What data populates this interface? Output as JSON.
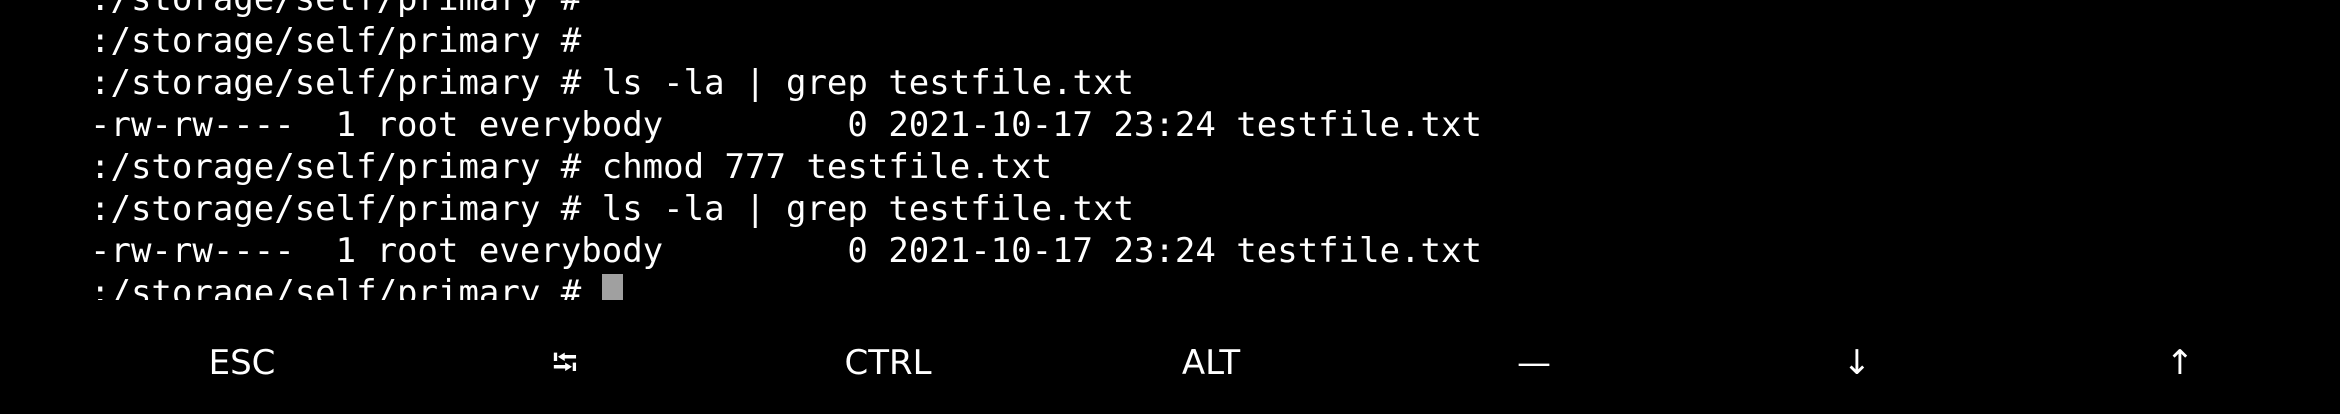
{
  "terminal": {
    "lines": [
      ":/storage/self/primary #",
      ":/storage/self/primary #",
      ":/storage/self/primary # ls -la | grep testfile.txt",
      "-rw-rw----  1 root everybody         0 2021-10-17 23:24 testfile.txt",
      ":/storage/self/primary # chmod 777 testfile.txt",
      ":/storage/self/primary # ls -la | grep testfile.txt",
      "-rw-rw----  1 root everybody         0 2021-10-17 23:24 testfile.txt"
    ],
    "prompt": ":/storage/self/primary #"
  },
  "extra_keys": {
    "esc": "ESC",
    "tab": "⭾",
    "ctrl": "CTRL",
    "alt": "ALT",
    "dash": "—",
    "down": "↓",
    "up": "↑"
  },
  "colors": {
    "background": "#000000",
    "text": "#ffffff",
    "cursor": "#a0a0a0"
  }
}
